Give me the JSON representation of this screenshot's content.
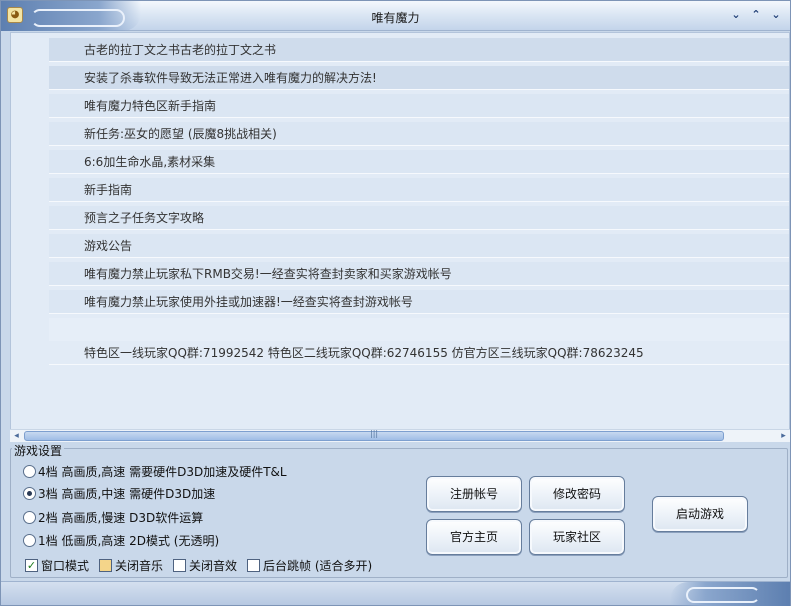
{
  "window": {
    "title": "唯有魔力",
    "controls": {
      "minimize": "⌄",
      "maximize": "⌃",
      "close": "⌄"
    }
  },
  "news_list": [
    {
      "text": "古老的拉丁文之书古老的拉丁文之书"
    },
    {
      "text": "安装了杀毒软件导致无法正常进入唯有魔力的解决方法!"
    },
    {
      "text": "唯有魔力特色区新手指南"
    },
    {
      "text": "新任务:巫女的愿望  (辰魔8挑战相关)"
    },
    {
      "text": "6:6加生命水晶,素材采集"
    },
    {
      "text": "新手指南"
    },
    {
      "text": "预言之子任务文字攻略"
    },
    {
      "text": "游戏公告"
    },
    {
      "text": "唯有魔力禁止玩家私下RMB交易!一经查实将查封卖家和买家游戏帐号"
    },
    {
      "text": "唯有魔力禁止玩家使用外挂或加速器!一经查实将查封游戏帐号"
    },
    {
      "text": ""
    },
    {
      "text": "特色区一线玩家QQ群:71992542 特色区二线玩家QQ群:62746155 仿官方区三线玩家QQ群:78623245"
    }
  ],
  "settings": {
    "legend": "游戏设置",
    "quality_options": [
      {
        "label": "4档 高画质,高速 需要硬件D3D加速及硬件T&L",
        "selected": false
      },
      {
        "label": "3档 高画质,中速 需硬件D3D加速",
        "selected": true
      },
      {
        "label": "2档 高画质,慢速 D3D软件运算",
        "selected": false
      },
      {
        "label": "1档 低画质,高速 2D模式 (无透明)",
        "selected": false
      }
    ],
    "checkboxes": [
      {
        "label": "窗口模式",
        "checked": true
      },
      {
        "label": "关闭音乐",
        "checked": false
      },
      {
        "label": "关闭音效",
        "checked": false
      },
      {
        "label": "后台跳帧 (适合多开)",
        "checked": false
      }
    ]
  },
  "buttons": {
    "register": "注册帐号",
    "change_password": "修改密码",
    "homepage": "官方主页",
    "community": "玩家社区",
    "launch": "启动游戏"
  },
  "icons": {
    "app": "app-icon",
    "scroll_left": "◂",
    "scroll_right": "▸"
  }
}
